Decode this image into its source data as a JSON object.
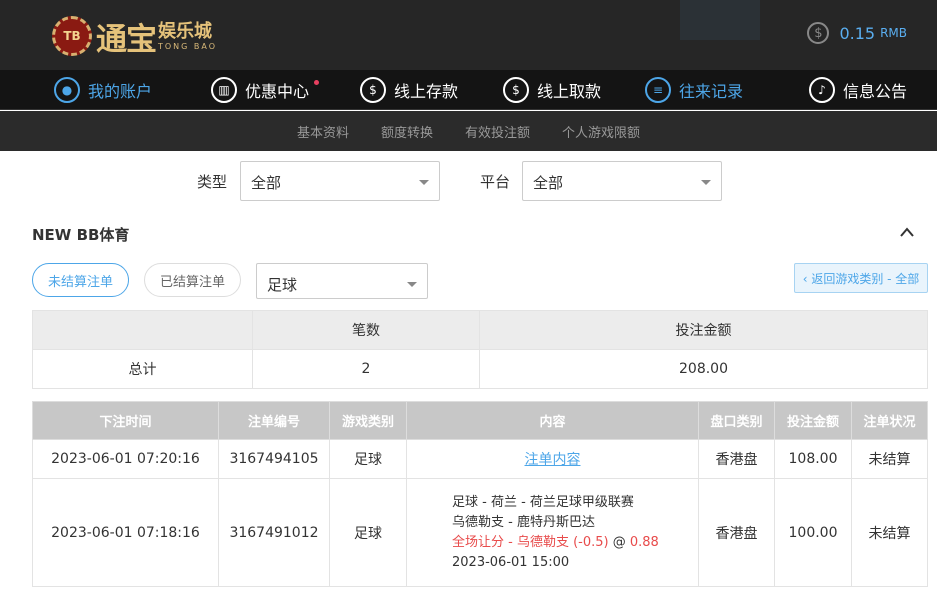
{
  "brand": {
    "chip": "TB",
    "big": "通宝",
    "small": "娱乐城",
    "eng": "TONG BAO"
  },
  "balance": {
    "icon": "dollar-coin-icon",
    "amount": "0.15",
    "currency": "RMB"
  },
  "nav": [
    {
      "label": "我的账户",
      "icon": "user-icon",
      "active": true
    },
    {
      "label": "优惠中心",
      "icon": "gift-icon",
      "active": false,
      "dot": true
    },
    {
      "label": "线上存款",
      "icon": "deposit-icon",
      "active": false
    },
    {
      "label": "线上取款",
      "icon": "withdraw-icon",
      "active": false
    },
    {
      "label": "往来记录",
      "icon": "record-icon",
      "active": true
    },
    {
      "label": "信息公告",
      "icon": "bell-icon",
      "active": false
    }
  ],
  "subnav": [
    "基本资料",
    "额度转换",
    "有效投注额",
    "个人游戏限额"
  ],
  "filters": {
    "type_label": "类型",
    "type_value": "全部",
    "platform_label": "平台",
    "platform_value": "全部"
  },
  "section": {
    "title": "NEW BB体育"
  },
  "tabs": {
    "unsettled": "未结算注单",
    "settled": "已结算注单",
    "sport": "足球",
    "back": "‹ 返回游戏类别 - 全部"
  },
  "summary": {
    "headers": [
      "",
      "笔数",
      "投注金额"
    ],
    "row": [
      "总计",
      "2",
      "208.00"
    ]
  },
  "bets": {
    "headers": [
      "下注时间",
      "注单编号",
      "游戏类别",
      "内容",
      "盘口类别",
      "投注金额",
      "注单状况"
    ],
    "rows": [
      {
        "time": "2023-06-01 07:20:16",
        "id": "3167494105",
        "game": "足球",
        "content_link": "注单内容",
        "market": "香港盘",
        "amount": "108.00",
        "status": "未结算"
      },
      {
        "time": "2023-06-01 07:18:16",
        "id": "3167491012",
        "game": "足球",
        "line1": "足球 - 荷兰 - 荷兰足球甲级联赛",
        "line2": "乌德勒支 - 鹿特丹斯巴达",
        "line3_red": "全场让分 - 乌德勒支 (-0.5)",
        "line3_at": " @ ",
        "line3_odds": "0.88",
        "line4": "2023-06-01 15:00",
        "market": "香港盘",
        "amount": "100.00",
        "status": "未结算"
      }
    ]
  }
}
